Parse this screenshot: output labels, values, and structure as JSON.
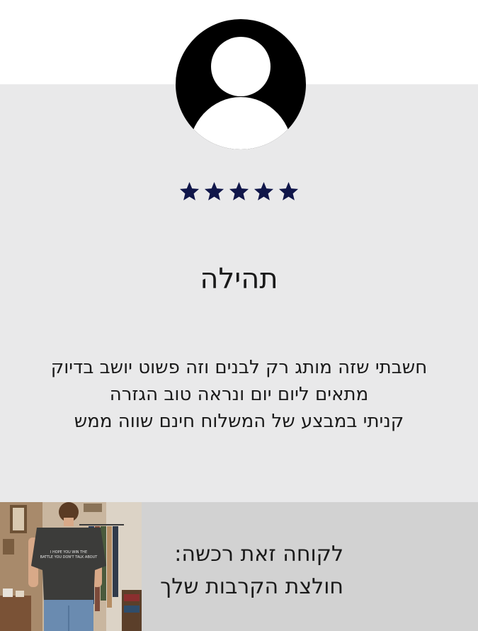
{
  "review": {
    "avatar_icon": "user-avatar-icon",
    "rating": 5,
    "rating_max": 5,
    "star_color": "#10164a",
    "reviewer_name": "תהילה",
    "text_lines": [
      "חשבתי שזה מותג רק לבנים וזה פשוט יושב בדיוק",
      "מתאים ליום יום ונראה טוב הגזרה",
      "קניתי במבצע של המשלוח חינם שווה ממש"
    ]
  },
  "purchase": {
    "label": "לקוחה זאת רכשה:",
    "product_name": "חולצת הקרבות שלך",
    "image_icon": "product-photo",
    "shirt_print_lines": [
      "I HOPE YOU WIN THE",
      "BATTLE YOU DON'T TALK ABOUT"
    ]
  },
  "colors": {
    "card_background": "#e9e9ea",
    "footer_background": "#d2d2d2",
    "star": "#10164a"
  }
}
